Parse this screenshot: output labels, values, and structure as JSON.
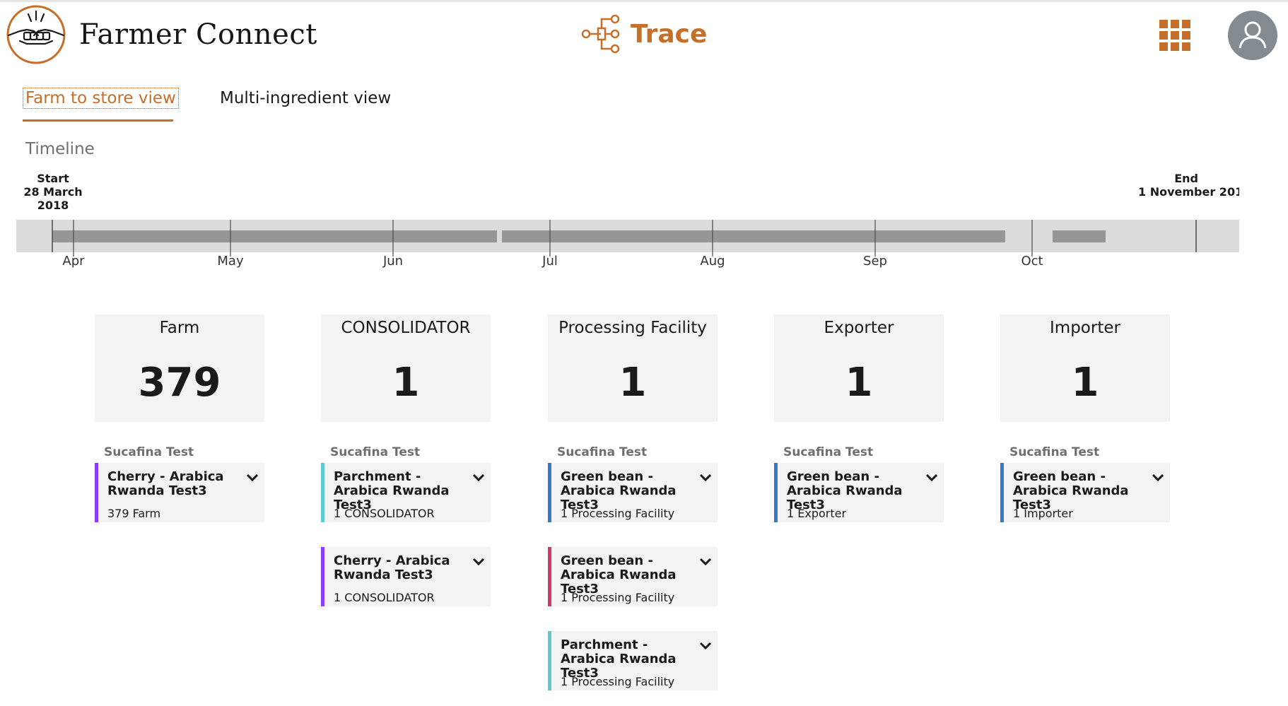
{
  "header": {
    "brand": "Farmer Connect",
    "app_title": "Trace",
    "accent_color": "#c4702b",
    "icons": [
      "handshake-logo-icon",
      "trace-network-icon",
      "app-grid-icon",
      "user-avatar-icon"
    ]
  },
  "tabs": [
    {
      "label": "Farm to store view",
      "active": true
    },
    {
      "label": "Multi-ingredient view",
      "active": false
    }
  ],
  "timeline": {
    "label": "Timeline",
    "start_label": "Start",
    "start_date": "28 March 2018",
    "end_label": "End",
    "end_date": "1 November 201",
    "months": [
      "Apr",
      "May",
      "Jun",
      "Jul",
      "Aug",
      "Sep",
      "Oct"
    ]
  },
  "stages": [
    {
      "name": "Farm",
      "count": "379",
      "org": "Sucafina Test",
      "cards": [
        {
          "title": "Cherry - Arabica Rwanda Test3",
          "sub": "379 Farm",
          "color": "#8a3ffc"
        }
      ]
    },
    {
      "name": "CONSOLIDATOR",
      "count": "1",
      "org": "Sucafina Test",
      "cards": [
        {
          "title": "Parchment - Arabica Rwanda Test3",
          "sub": "1 CONSOLIDATOR",
          "color": "#5ecad0"
        },
        {
          "title": "Cherry - Arabica Rwanda Test3",
          "sub": "1 CONSOLIDATOR",
          "color": "#8a3ffc"
        }
      ]
    },
    {
      "name": "Processing Facility",
      "count": "1",
      "org": "Sucafina Test",
      "cards": [
        {
          "title": "Green bean - Arabica Rwanda Test3",
          "sub": "1 Processing Facility",
          "color": "#3a78c9"
        },
        {
          "title": "Green bean - Arabica Rwanda Test3",
          "sub": "1 Processing Facility",
          "color": "#d2386c"
        },
        {
          "title": "Parchment - Arabica Rwanda Test3",
          "sub": "1 Processing Facility",
          "color": "#5ecad0"
        }
      ]
    },
    {
      "name": "Exporter",
      "count": "1",
      "org": "Sucafina Test",
      "cards": [
        {
          "title": "Green bean - Arabica Rwanda Test3",
          "sub": "1 Exporter",
          "color": "#3a78c9"
        }
      ]
    },
    {
      "name": "Importer",
      "count": "1",
      "org": "Sucafina Test",
      "cards": [
        {
          "title": "Green bean - Arabica Rwanda Test3",
          "sub": "1 Importer",
          "color": "#3a78c9"
        }
      ]
    }
  ]
}
